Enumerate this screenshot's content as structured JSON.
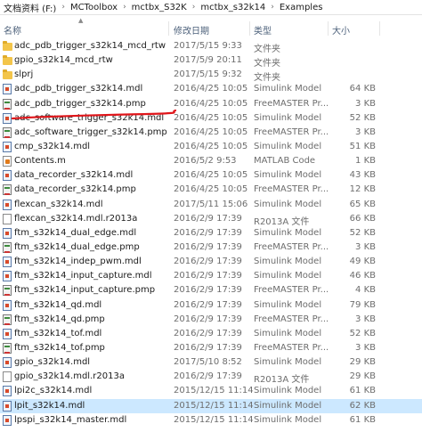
{
  "breadcrumb": [
    {
      "label": "文档资料 (F:)"
    },
    {
      "label": "MCToolbox"
    },
    {
      "label": "mctbx_S32K"
    },
    {
      "label": "mctbx_s32k14"
    },
    {
      "label": "Examples"
    }
  ],
  "columns": {
    "name": "名称",
    "date": "修改日期",
    "type": "类型",
    "size": "大小"
  },
  "files": [
    {
      "name": "adc_pdb_trigger_s32k14_mcd_rtw",
      "date": "2017/5/15 9:33",
      "type": "文件夹",
      "size": "",
      "icon": "folder-icon"
    },
    {
      "name": "gpio_s32k14_mcd_rtw",
      "date": "2017/5/9 20:11",
      "type": "文件夹",
      "size": "",
      "icon": "folder-icon"
    },
    {
      "name": "slprj",
      "date": "2017/5/15 9:32",
      "type": "文件夹",
      "size": "",
      "icon": "folder-icon"
    },
    {
      "name": "adc_pdb_trigger_s32k14.mdl",
      "date": "2016/4/25 10:05",
      "type": "Simulink Model",
      "size": "64 KB",
      "icon": "simulink-model-icon"
    },
    {
      "name": "adc_pdb_trigger_s32k14.pmp",
      "date": "2016/4/25 10:05",
      "type": "FreeMASTER Pr...",
      "size": "3 KB",
      "icon": "freemaster-project-icon"
    },
    {
      "name": "adc_software_trigger_s32k14.mdl",
      "date": "2016/4/25 10:05",
      "type": "Simulink Model",
      "size": "52 KB",
      "icon": "simulink-model-icon"
    },
    {
      "name": "adc_software_trigger_s32k14.pmp",
      "date": "2016/4/25 10:05",
      "type": "FreeMASTER Pr...",
      "size": "3 KB",
      "icon": "freemaster-project-icon"
    },
    {
      "name": "cmp_s32k14.mdl",
      "date": "2016/4/25 10:05",
      "type": "Simulink Model",
      "size": "51 KB",
      "icon": "simulink-model-icon"
    },
    {
      "name": "Contents.m",
      "date": "2016/5/2 9:53",
      "type": "MATLAB Code",
      "size": "1 KB",
      "icon": "matlab-code-icon"
    },
    {
      "name": "data_recorder_s32k14.mdl",
      "date": "2016/4/25 10:05",
      "type": "Simulink Model",
      "size": "43 KB",
      "icon": "simulink-model-icon"
    },
    {
      "name": "data_recorder_s32k14.pmp",
      "date": "2016/4/25 10:05",
      "type": "FreeMASTER Pr...",
      "size": "12 KB",
      "icon": "freemaster-project-icon"
    },
    {
      "name": "flexcan_s32k14.mdl",
      "date": "2017/5/11 15:06",
      "type": "Simulink Model",
      "size": "65 KB",
      "icon": "simulink-model-icon"
    },
    {
      "name": "flexcan_s32k14.mdl.r2013a",
      "date": "2016/2/9 17:39",
      "type": "R2013A 文件",
      "size": "66 KB",
      "icon": "generic-file-icon"
    },
    {
      "name": "ftm_s32k14_dual_edge.mdl",
      "date": "2016/2/9 17:39",
      "type": "Simulink Model",
      "size": "52 KB",
      "icon": "simulink-model-icon"
    },
    {
      "name": "ftm_s32k14_dual_edge.pmp",
      "date": "2016/2/9 17:39",
      "type": "FreeMASTER Pr...",
      "size": "3 KB",
      "icon": "freemaster-project-icon"
    },
    {
      "name": "ftm_s32k14_indep_pwm.mdl",
      "date": "2016/2/9 17:39",
      "type": "Simulink Model",
      "size": "49 KB",
      "icon": "simulink-model-icon"
    },
    {
      "name": "ftm_s32k14_input_capture.mdl",
      "date": "2016/2/9 17:39",
      "type": "Simulink Model",
      "size": "46 KB",
      "icon": "simulink-model-icon"
    },
    {
      "name": "ftm_s32k14_input_capture.pmp",
      "date": "2016/2/9 17:39",
      "type": "FreeMASTER Pr...",
      "size": "4 KB",
      "icon": "freemaster-project-icon"
    },
    {
      "name": "ftm_s32k14_qd.mdl",
      "date": "2016/2/9 17:39",
      "type": "Simulink Model",
      "size": "79 KB",
      "icon": "simulink-model-icon"
    },
    {
      "name": "ftm_s32k14_qd.pmp",
      "date": "2016/2/9 17:39",
      "type": "FreeMASTER Pr...",
      "size": "3 KB",
      "icon": "freemaster-project-icon"
    },
    {
      "name": "ftm_s32k14_tof.mdl",
      "date": "2016/2/9 17:39",
      "type": "Simulink Model",
      "size": "52 KB",
      "icon": "simulink-model-icon"
    },
    {
      "name": "ftm_s32k14_tof.pmp",
      "date": "2016/2/9 17:39",
      "type": "FreeMASTER Pr...",
      "size": "3 KB",
      "icon": "freemaster-project-icon"
    },
    {
      "name": "gpio_s32k14.mdl",
      "date": "2017/5/10 8:52",
      "type": "Simulink Model",
      "size": "29 KB",
      "icon": "simulink-model-icon"
    },
    {
      "name": "gpio_s32k14.mdl.r2013a",
      "date": "2016/2/9 17:39",
      "type": "R2013A 文件",
      "size": "29 KB",
      "icon": "generic-file-icon"
    },
    {
      "name": "lpi2c_s32k14.mdl",
      "date": "2015/12/15 11:14",
      "type": "Simulink Model",
      "size": "61 KB",
      "icon": "simulink-model-icon"
    },
    {
      "name": "lpit_s32k14.mdl",
      "date": "2015/12/15 11:14",
      "type": "Simulink Model",
      "size": "62 KB",
      "icon": "simulink-model-icon",
      "selected": true
    },
    {
      "name": "lpspi_s32k14_master.mdl",
      "date": "2015/12/15 11:14",
      "type": "Simulink Model",
      "size": "61 KB",
      "icon": "simulink-model-icon"
    }
  ],
  "colors": {
    "annotation_stroke": "#e0151a",
    "selected_row": "#cce8ff",
    "header_text": "#4c607a"
  }
}
